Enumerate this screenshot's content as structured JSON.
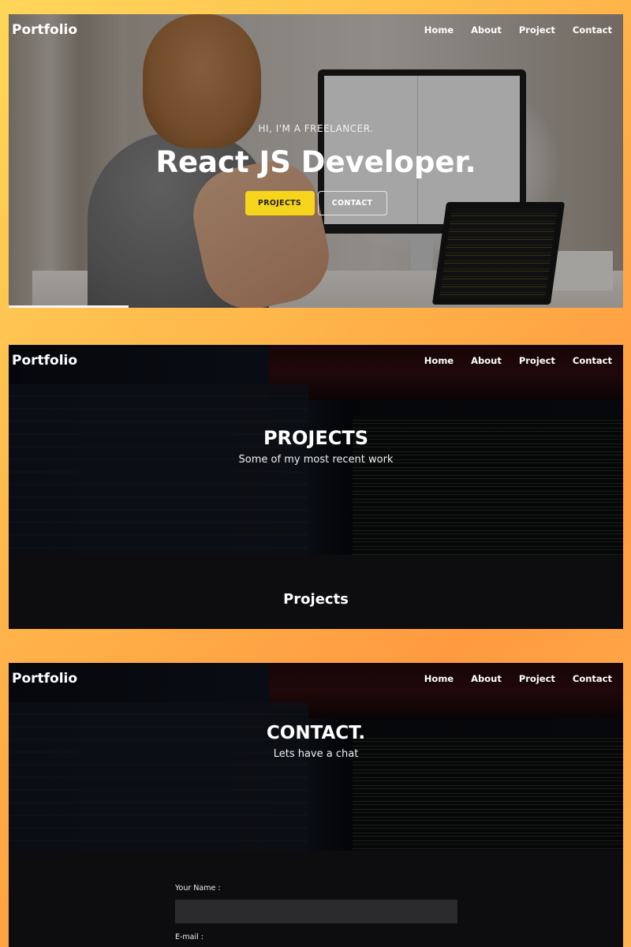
{
  "brand": "Portfolio",
  "nav": [
    "Home",
    "About",
    "Project",
    "Contact"
  ],
  "hero": {
    "subtitle": "HI, I'M A FREELANCER.",
    "title": "React JS Developer.",
    "primary_button": "PROJECTS",
    "secondary_button": "CONTACT"
  },
  "projects_page": {
    "title": "PROJECTS",
    "subtitle": "Some of my most recent work",
    "section_heading": "Projects"
  },
  "contact_page": {
    "title": "CONTACT.",
    "subtitle": "Lets have a chat",
    "name_label": "Your Name :",
    "name_value": "",
    "email_label": "E-mail :"
  },
  "colors": {
    "accent": "#f7d51d",
    "dark_bg": "#0d0d0f",
    "page_gradient": "#ffb44a"
  }
}
